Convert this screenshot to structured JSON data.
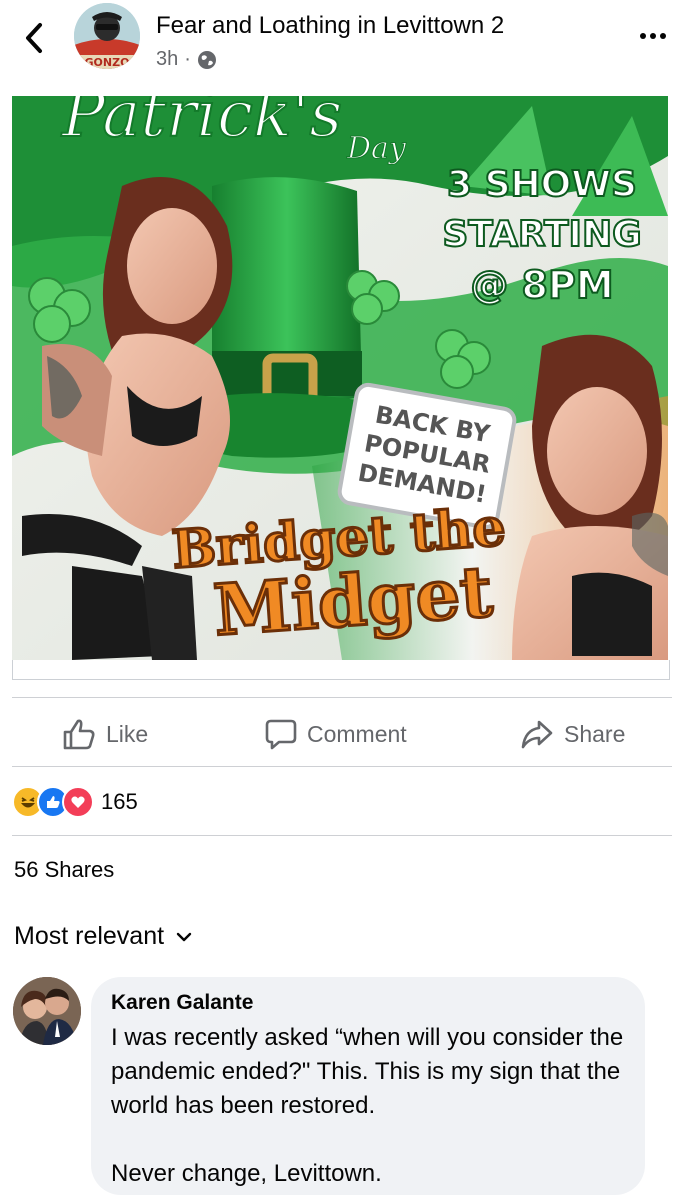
{
  "post": {
    "page_name": "Fear and Loathing in Levittown 2",
    "time": "3h",
    "privacy_icon": "globe-icon",
    "avatar_text": "GONZO"
  },
  "poster": {
    "script_title": "Patrick's",
    "day": "Day",
    "shows": [
      "3 SHOWS",
      "STARTING",
      "@ 8PM"
    ],
    "badge": [
      "BACK BY",
      "POPULAR",
      "DEMAND!"
    ],
    "headline": [
      "Bridget the",
      "Midget"
    ]
  },
  "actions": {
    "like": "Like",
    "comment": "Comment",
    "share": "Share"
  },
  "reactions": {
    "icons": [
      "haha-icon",
      "like-icon",
      "love-icon"
    ],
    "count": "165"
  },
  "shares_text": "56 Shares",
  "sort_label": "Most relevant",
  "comment": {
    "author": "Karen Galante",
    "text_1": "I was recently asked “when will you consider the pandemic ended?\" This. This is my sign that the world has been restored.",
    "text_2": "Never change, Levittown."
  },
  "colors": {
    "text_primary": "#050505",
    "text_secondary": "#65676b",
    "bubble": "#f0f2f5",
    "like_blue": "#1877f2",
    "love_red": "#f33e58",
    "haha_yellow": "#f7b928",
    "poster_green": "#1f9a3a",
    "poster_orange": "#f08a24"
  }
}
